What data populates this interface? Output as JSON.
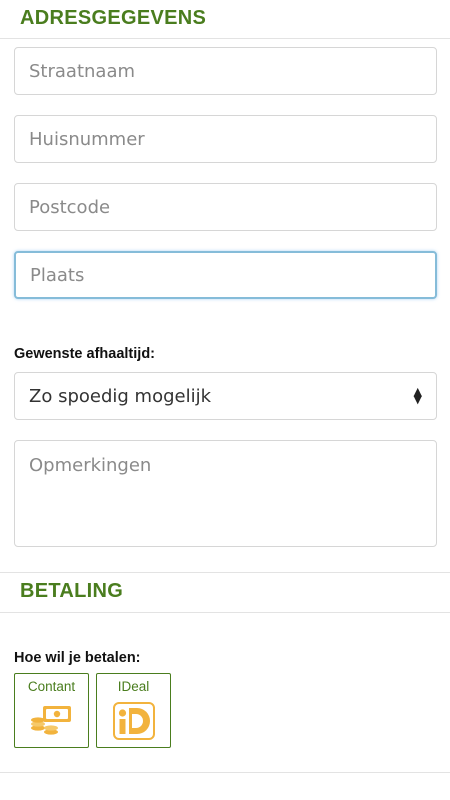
{
  "address": {
    "title": "ADRESGEGEVENS",
    "street_placeholder": "Straatnaam",
    "house_number_placeholder": "Huisnummer",
    "postcode_placeholder": "Postcode",
    "city_placeholder": "Plaats"
  },
  "pickup": {
    "label": "Gewenste afhaaltijd:",
    "selected": "Zo spoedig mogelijk"
  },
  "remarks": {
    "placeholder": "Opmerkingen"
  },
  "payment": {
    "title": "BETALING",
    "question": "Hoe wil je betalen:",
    "options": [
      {
        "label": "Contant",
        "icon": "cash-coins-icon"
      },
      {
        "label": "IDeal",
        "icon": "ideal-logo-icon"
      }
    ]
  },
  "colors": {
    "accent_green": "#4a7d1e",
    "icon_orange": "#f2b33d",
    "focus_border": "#85bcd9"
  }
}
